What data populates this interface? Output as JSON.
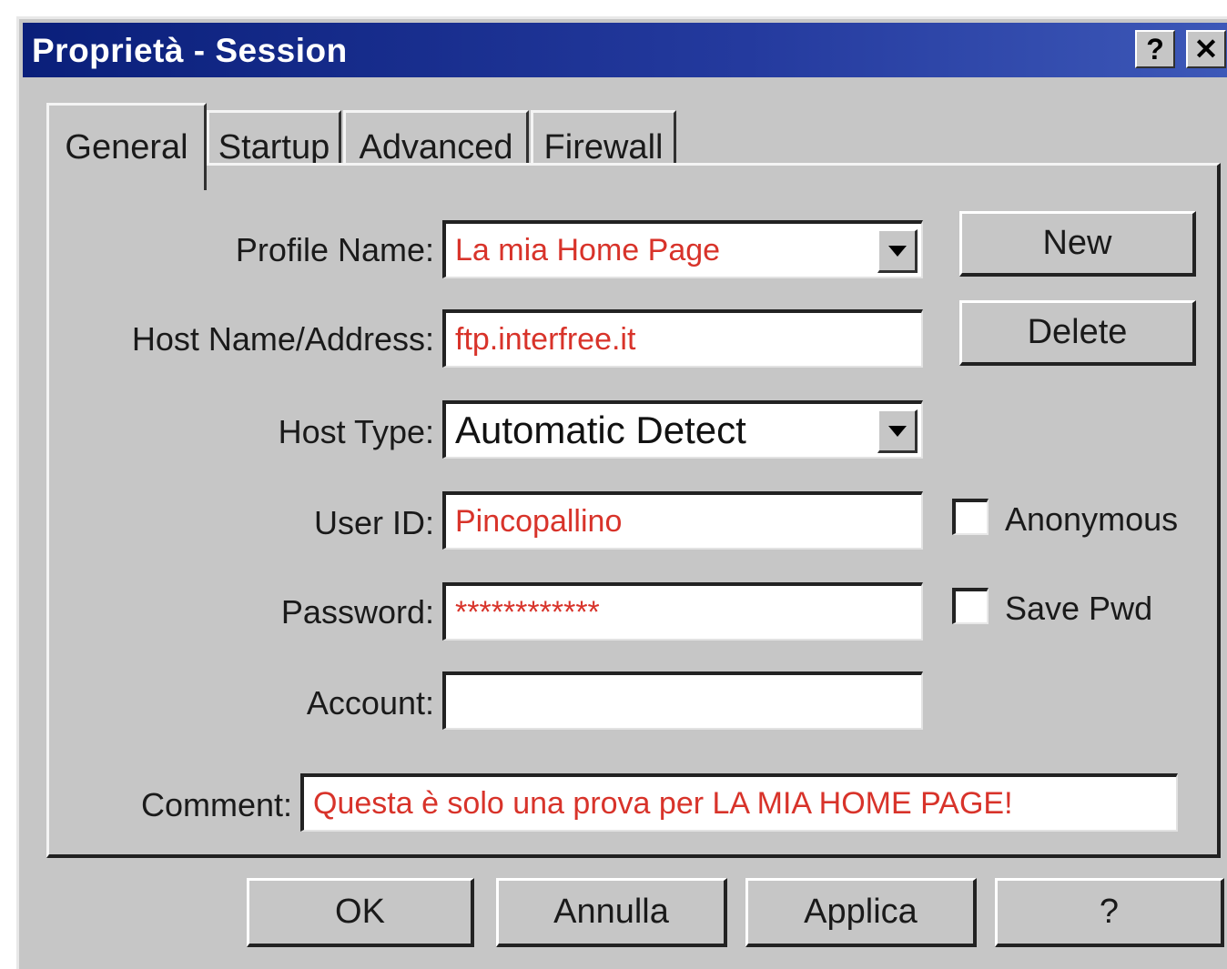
{
  "window": {
    "title": "Proprietà - Session",
    "help_button": "?",
    "close_button": "✕"
  },
  "tabs": [
    {
      "label": "General",
      "active": true
    },
    {
      "label": "Startup",
      "active": false
    },
    {
      "label": "Advanced",
      "active": false
    },
    {
      "label": "Firewall",
      "active": false
    }
  ],
  "form": {
    "profile_name": {
      "label": "Profile Name:",
      "value": "La mia Home Page"
    },
    "host_name": {
      "label": "Host Name/Address:",
      "value": "ftp.interfree.it"
    },
    "host_type": {
      "label": "Host Type:",
      "value": "Automatic Detect"
    },
    "user_id": {
      "label": "User ID:",
      "value": "Pincopallino"
    },
    "password": {
      "label": "Password:",
      "value": "************"
    },
    "account": {
      "label": "Account:",
      "value": ""
    },
    "comment": {
      "label": "Comment:",
      "value": "Questa è solo una prova per LA MIA HOME PAGE!"
    }
  },
  "side_buttons": {
    "new_label": "New",
    "delete_label": "Delete"
  },
  "checkboxes": {
    "anonymous": {
      "label": "Anonymous",
      "checked": false
    },
    "save_pwd": {
      "label": "Save Pwd",
      "checked": false
    }
  },
  "footer_buttons": {
    "ok": "OK",
    "cancel": "Annulla",
    "apply": "Applica",
    "help": "?"
  },
  "colors": {
    "title_bar": "#0a1f7a",
    "dialog_face": "#c6c6c6",
    "field_text": "#d8332a"
  }
}
